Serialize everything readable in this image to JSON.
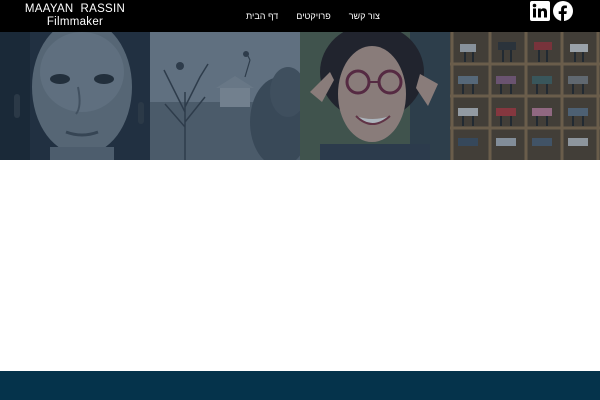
{
  "brand": {
    "name": "MAAYAN  RASSIN",
    "tagline": "Filmmaker"
  },
  "nav": {
    "items": [
      {
        "label": "דף הבית"
      },
      {
        "label": "פרויקטים"
      },
      {
        "label": "צור קשר"
      }
    ]
  },
  "social": [
    {
      "icon": "linkedin-icon"
    },
    {
      "icon": "facebook-icon"
    }
  ],
  "gallery": [
    {
      "subject": "portrait-woman"
    },
    {
      "subject": "foggy-landscape"
    },
    {
      "subject": "smiling-woman-glasses"
    },
    {
      "subject": "chairs-on-shelves"
    }
  ],
  "colors": {
    "header_bg": "#000000",
    "footer_bg": "#05334b",
    "tile_tint": "#12283e"
  }
}
